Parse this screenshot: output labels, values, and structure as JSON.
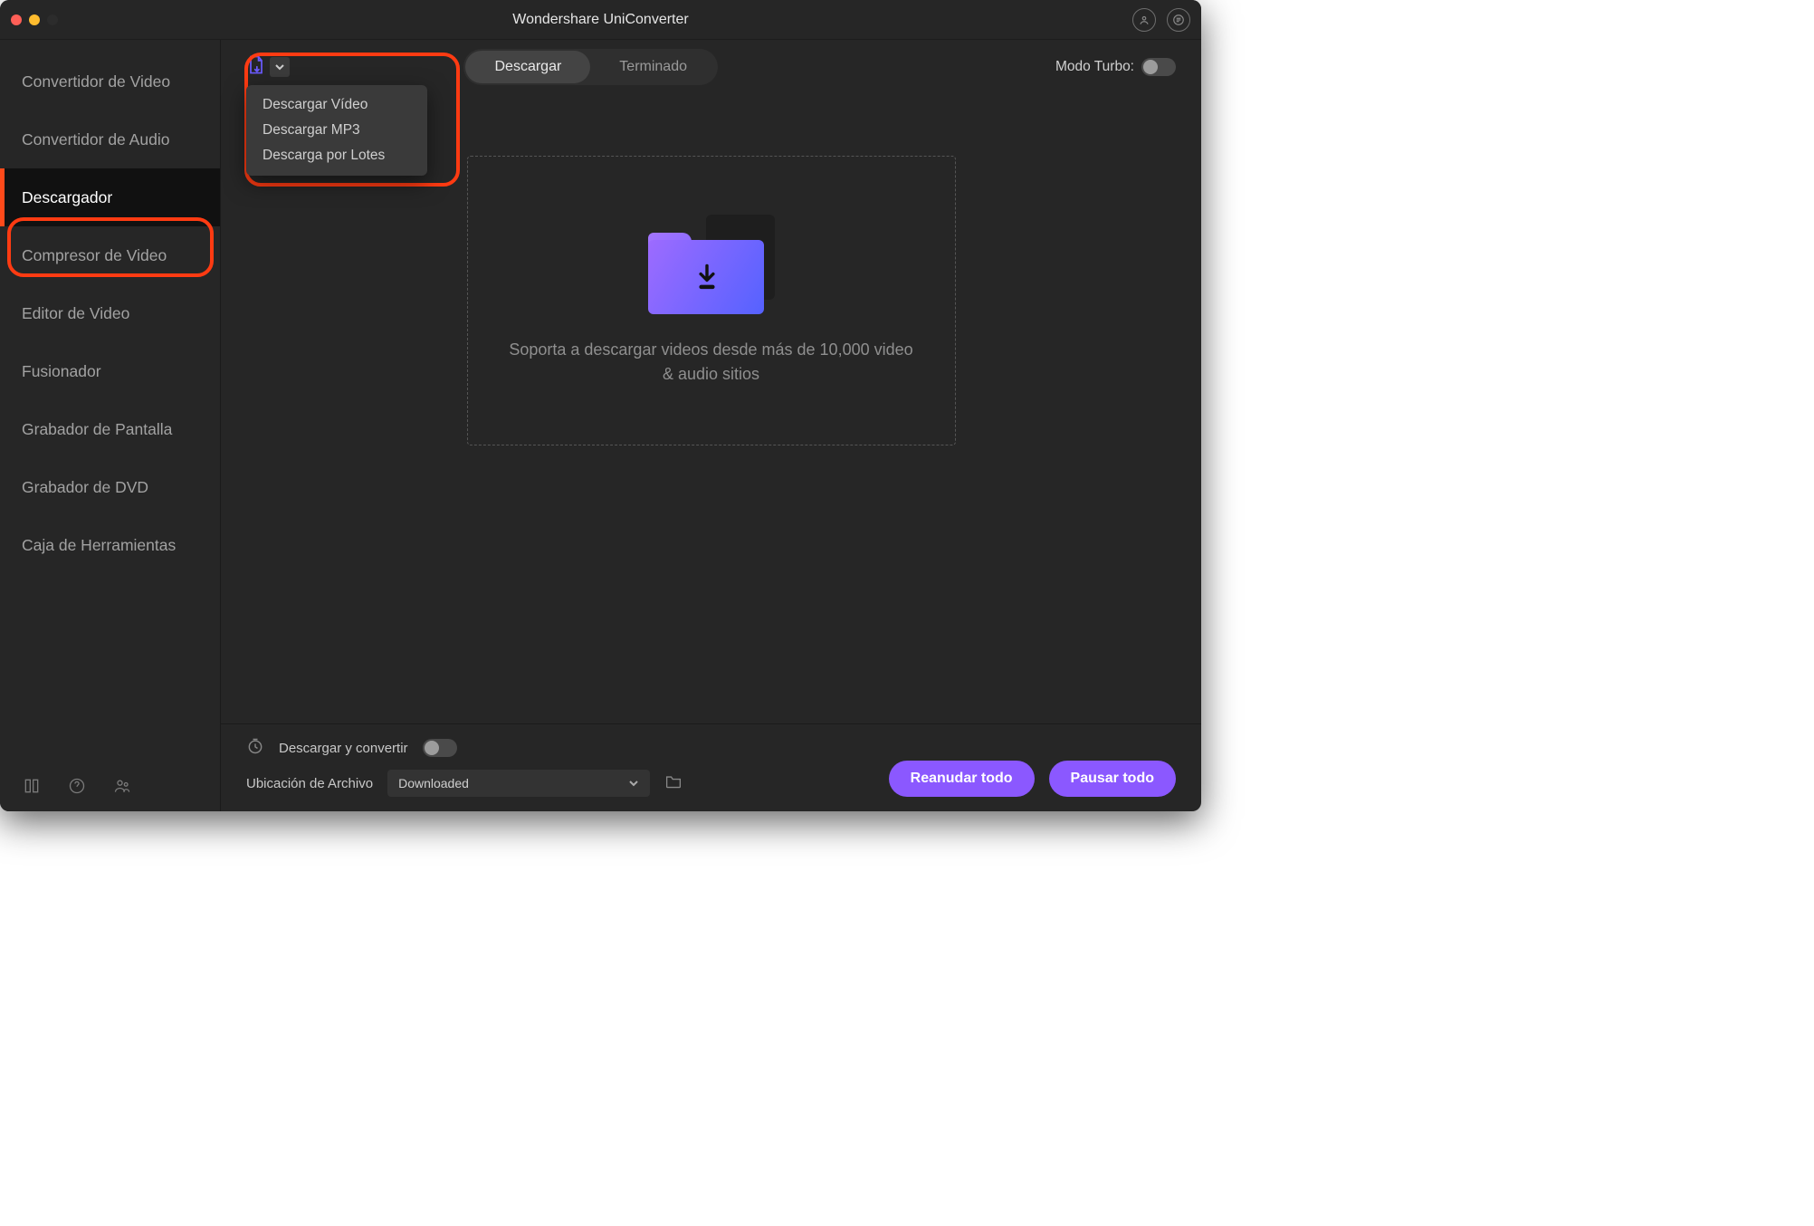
{
  "title": "Wondershare UniConverter",
  "sidebar": {
    "items": [
      {
        "id": "video-converter",
        "label": "Convertidor de Video"
      },
      {
        "id": "audio-converter",
        "label": "Convertidor de Audio"
      },
      {
        "id": "downloader",
        "label": "Descargador"
      },
      {
        "id": "video-compressor",
        "label": "Compresor de Video"
      },
      {
        "id": "video-editor",
        "label": "Editor de Video"
      },
      {
        "id": "merger",
        "label": "Fusionador"
      },
      {
        "id": "screen-recorder",
        "label": "Grabador de Pantalla"
      },
      {
        "id": "dvd-burner",
        "label": "Grabador de DVD"
      },
      {
        "id": "toolbox",
        "label": "Caja de Herramientas"
      }
    ],
    "active_index": 2
  },
  "dropdown": {
    "items": [
      {
        "id": "download-video",
        "label": "Descargar Vídeo"
      },
      {
        "id": "download-mp3",
        "label": "Descargar MP3"
      },
      {
        "id": "batch-download",
        "label": "Descarga por Lotes"
      }
    ]
  },
  "segment": {
    "items": [
      {
        "id": "downloading",
        "label": "Descargar"
      },
      {
        "id": "finished",
        "label": "Terminado"
      }
    ],
    "active_index": 0
  },
  "turbo": {
    "label": "Modo Turbo:"
  },
  "dropzone": {
    "text": "Soporta a descargar videos desde más de 10,000 video & audio sitios"
  },
  "bottom": {
    "convert_label": "Descargar y convertir",
    "location_label": "Ubicación de Archivo",
    "location_value": "Downloaded",
    "resume_label": "Reanudar todo",
    "pause_label": "Pausar todo"
  }
}
